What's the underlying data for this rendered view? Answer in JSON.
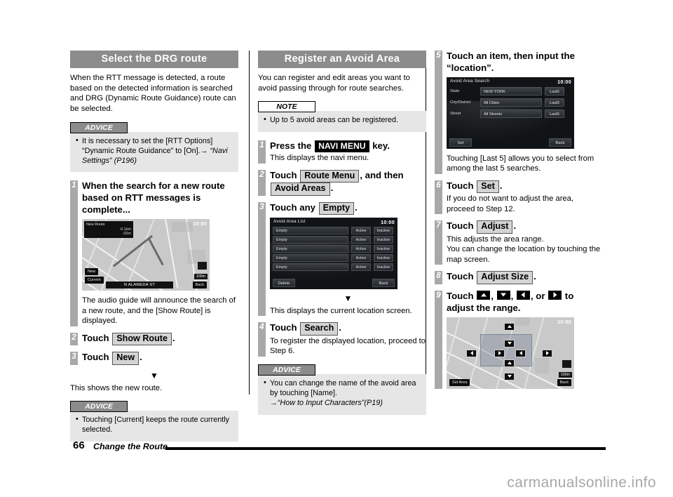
{
  "page": {
    "number": "66",
    "chapter_title": "Change the Route",
    "watermark": "carmanualsonline.info"
  },
  "column1": {
    "section_title": "Select the DRG route",
    "intro": "When the RTT message is detected, a route based on the detected information is searched and DRG (Dynamic Route Guidance) route can be selected.",
    "advice": {
      "label": "ADVICE",
      "text_plain": "It is necessary to set the [RTT Options] “Dynamic Route Guidance” to [On].→",
      "text_italic": "“Navi Settings” (P196)"
    },
    "step1": {
      "num": "1",
      "title": "When the search for a new route based on RTT messages is complete...",
      "caption": "The audio guide will announce the search of a new route, and the [Show Route] is displayed."
    },
    "map_shot": {
      "panel_title": "New Route",
      "panel_distance": "-0.1km",
      "panel_time": "-02m",
      "btn_new": "New",
      "btn_current": "Current",
      "street": "N ALAMEDA ST",
      "btn_back": "Back",
      "time": "10:00",
      "scale": "100m"
    },
    "step2": {
      "num": "2",
      "pre": "Touch",
      "key": "Show Route",
      "post": "."
    },
    "step3": {
      "num": "3",
      "pre": "Touch",
      "key": "New",
      "post": "."
    },
    "after_arrow": "This shows the new route.",
    "advice2": {
      "label": "ADVICE",
      "text": "Touching [Current] keeps the route currently selected."
    }
  },
  "column2": {
    "section_title": "Register an Avoid Area",
    "intro": "You can register and edit areas you want to avoid passing through for route searches.",
    "note": {
      "label": "NOTE",
      "text": "Up to 5 avoid areas can be registered."
    },
    "step1": {
      "num": "1",
      "pre": "Press the",
      "key": "NAVI MENU",
      "post": "key.",
      "sub": "This displays the navi menu."
    },
    "step2": {
      "num": "2",
      "pre": "Touch",
      "key1": "Route Menu",
      "mid": ", and then",
      "key2": "Avoid Areas",
      "post": "."
    },
    "step3": {
      "num": "3",
      "pre": "Touch any",
      "key": "Empty",
      "post": "."
    },
    "list_shot": {
      "title": "Avoid Area List",
      "time": "10:00",
      "rows": [
        {
          "label": "Empty",
          "active": "Active",
          "inactive": "Inactive"
        },
        {
          "label": "Empty",
          "active": "Active",
          "inactive": "Inactive"
        },
        {
          "label": "Empty",
          "active": "Active",
          "inactive": "Inactive"
        },
        {
          "label": "Empty",
          "active": "Active",
          "inactive": "Inactive"
        },
        {
          "label": "Empty",
          "active": "Active",
          "inactive": "Inactive"
        }
      ],
      "btn_delete": "Delete",
      "btn_back": "Back"
    },
    "after_arrow": "This displays the current location screen.",
    "step4": {
      "num": "4",
      "pre": "Touch",
      "key": "Search",
      "post": ".",
      "sub": "To register the displayed location, proceed to Step 6."
    },
    "advice": {
      "label": "ADVICE",
      "text_plain": "You can change the name of the avoid area by touching [Name].",
      "arrow": "→",
      "text_italic": "“How to Input Characters”(P19)"
    }
  },
  "column3": {
    "step5": {
      "num": "5",
      "title": "Touch an item, then input the “location”.",
      "caption": "Touching [Last 5] allows you to select from among the last 5 searches."
    },
    "search_shot": {
      "title": "Avoid Area Search",
      "time": "10:00",
      "rows": [
        {
          "label": "State",
          "value": "NEW YORK",
          "last": "Last5"
        },
        {
          "label": "City/District",
          "value": "All Cities",
          "last": "Last5"
        },
        {
          "label": "Street",
          "value": "All Streets",
          "last": "Last5"
        }
      ],
      "btn_set": "Set",
      "btn_back": "Back"
    },
    "step6": {
      "num": "6",
      "pre": "Touch",
      "key": "Set",
      "post": ".",
      "sub": "If you do not want to adjust the area, proceed to Step 12."
    },
    "step7": {
      "num": "7",
      "pre": "Touch",
      "key": "Adjust",
      "post": ".",
      "sub": "This adjusts the area range.\nYou can change the location by touching the map screen."
    },
    "step8": {
      "num": "8",
      "pre": "Touch",
      "key": "Adjust Size",
      "post": "."
    },
    "step9": {
      "num": "9",
      "pre": "Touch",
      "sep1": ",",
      "sep2": ",",
      "sep3": ", or",
      "post": "to adjust the range."
    },
    "adjust_shot": {
      "time": "10:00",
      "btn_set_area": "Set Area",
      "btn_back": "Back",
      "scale": "100m"
    }
  },
  "icons": {
    "arrow_up": "arrow-up-icon",
    "arrow_down": "arrow-down-icon",
    "arrow_left": "arrow-left-icon",
    "arrow_right": "arrow-right-icon",
    "down_triangle": "▼"
  }
}
